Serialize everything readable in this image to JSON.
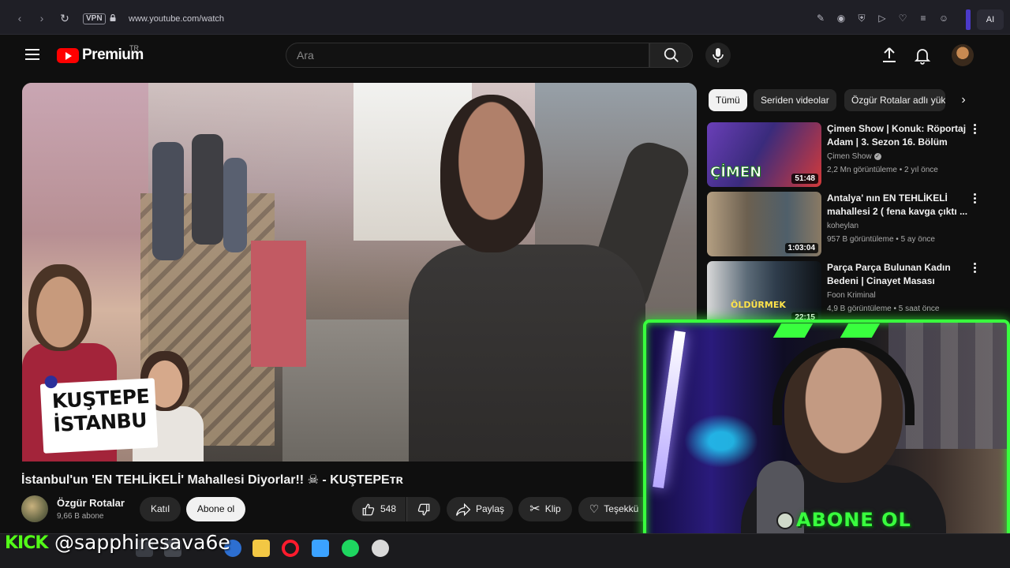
{
  "browser": {
    "vpn_label": "VPN",
    "url": "www.youtube.com/watch",
    "ai_label": "AI"
  },
  "header": {
    "logo_text": "Premium",
    "country": "TR",
    "search_placeholder": "Ara"
  },
  "video": {
    "sticker_line1": "KUŞTEPE",
    "sticker_line2": "İSTANBU",
    "title": "İstanbul'un 'EN TEHLİKELİ' Mahallesi Diyorlar!! ☠ - KUŞTEPEᴛʀ",
    "channel_name": "Özgür Rotalar",
    "subscribers": "9,66 B abone",
    "join_label": "Katıl",
    "subscribe_label": "Abone ol",
    "like_count": "548",
    "share_label": "Paylaş",
    "clip_label": "Klip",
    "thanks_label": "Teşekkü"
  },
  "chips": [
    "Tümü",
    "Seriden videolar",
    "Özgür Rotalar adlı yük"
  ],
  "recommendations": [
    {
      "title": "Çimen Show | Konuk: Röportaj Adam | 3. Sezon 16. Bölüm",
      "channel": "Çimen Show",
      "verified": true,
      "views": "2,2 Mn görüntüleme",
      "age": "2 yıl önce",
      "duration": "51:48",
      "colors": [
        "#6a3fb8",
        "#d33a3a"
      ]
    },
    {
      "title": "Antalya' nın EN TEHLİKELİ mahallesi 2 ( fena kavga çıktı ...",
      "channel": "koheylan",
      "verified": false,
      "views": "957 B görüntüleme",
      "age": "5 ay önce",
      "duration": "1:03:04",
      "colors": [
        "#8a7a64",
        "#4f5f6a"
      ]
    },
    {
      "title": "Parça Parça Bulunan Kadın Bedeni | Cinayet Masası",
      "channel": "Foon Kriminal",
      "verified": false,
      "views": "4,9 B görüntüleme",
      "age": "5 saat önce",
      "duration": "22:15",
      "colors": [
        "#2f3d4c",
        "#0e1216"
      ]
    }
  ],
  "overlay": {
    "subscribe_text": "ABONE OL",
    "kick_tag": "KICK",
    "kick_handle": "@sapphiresava6e",
    "accent": "#39ff3e"
  }
}
